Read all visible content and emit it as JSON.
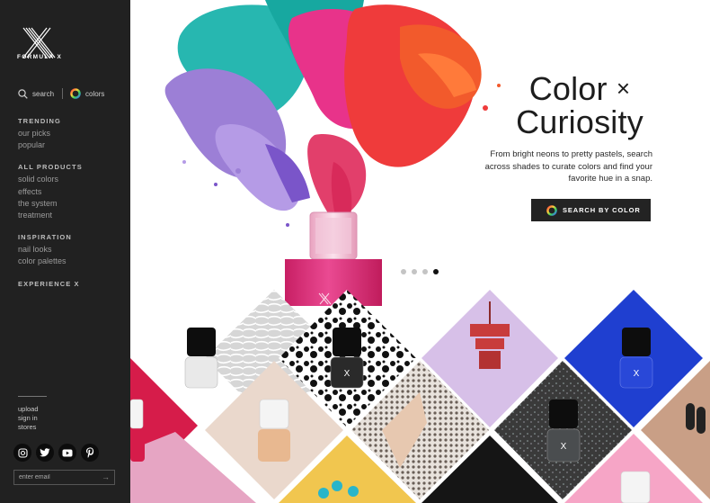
{
  "brand": {
    "logo_text": "FORMULA X"
  },
  "utility": {
    "search_label": "search",
    "colors_label": "colors"
  },
  "nav": [
    {
      "heading": "TRENDING",
      "items": [
        "our picks",
        "popular"
      ]
    },
    {
      "heading": "ALL PRODUCTS",
      "items": [
        "solid colors",
        "effects",
        "the system",
        "treatment"
      ]
    },
    {
      "heading": "INSPIRATION",
      "items": [
        "nail looks",
        "color palettes"
      ]
    },
    {
      "heading": "EXPERIENCE X",
      "items": []
    }
  ],
  "footer": {
    "links": [
      "upload",
      "sign in",
      "stores"
    ],
    "social_icons": [
      "instagram-icon",
      "twitter-icon",
      "youtube-icon",
      "pinterest-icon"
    ],
    "email_placeholder": "enter email"
  },
  "hero": {
    "title_line1": "Color",
    "title_x": "×",
    "title_line2": "Curiosity",
    "description": "From bright neons to pretty pastels, search across shades to curate colors and find your favorite hue in a snap.",
    "cta_label": "SEARCH BY COLOR",
    "slides": 4,
    "active_slide": 4
  },
  "colors": {
    "sidebar_bg": "#212121",
    "cta_bg": "#232323",
    "polish_pink": "#e0357f",
    "tile_blue": "#1f3fd0",
    "tile_pink": "#f6a5c6"
  }
}
